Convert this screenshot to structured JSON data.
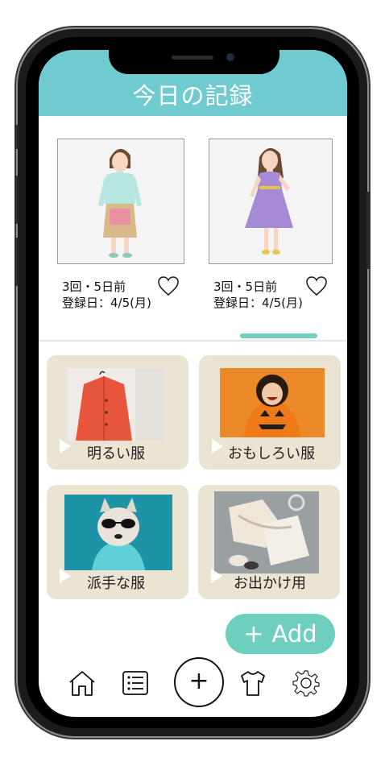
{
  "header": {
    "title": "今日の記録"
  },
  "records": [
    {
      "count_text": "3回・5日前",
      "date_text": "登録日：4/5(月)"
    },
    {
      "count_text": "3回・5日前",
      "date_text": "登録日：4/5(月)"
    }
  ],
  "categories": [
    {
      "label": "明るい服"
    },
    {
      "label": "おもしろい服"
    },
    {
      "label": "派手な服"
    },
    {
      "label": "お出かけ用"
    }
  ],
  "add_button": {
    "label": "Add"
  },
  "tabbar": {
    "fab_label": "+"
  },
  "colors": {
    "accent": "#6fcbd0",
    "mint": "#6ecfbe",
    "card_bg": "#ece4d3"
  }
}
